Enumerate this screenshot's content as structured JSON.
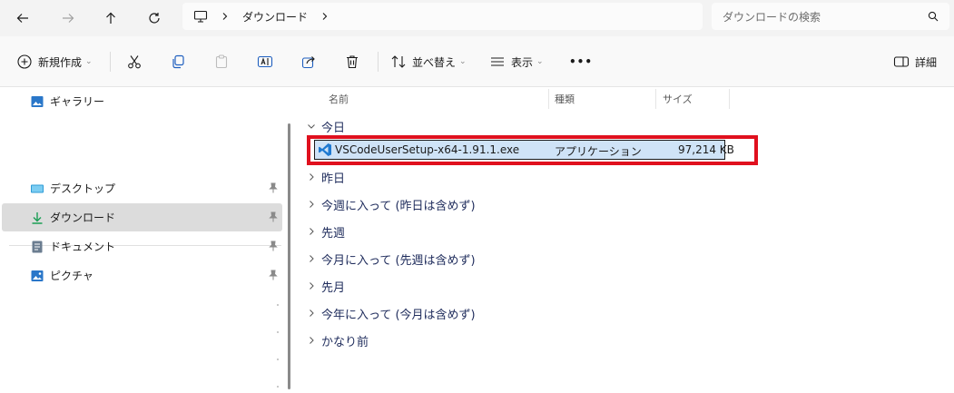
{
  "nav": {
    "back_icon": "arrow-left-icon",
    "forward_icon": "arrow-right-icon",
    "up_icon": "arrow-up-icon",
    "refresh_icon": "refresh-icon"
  },
  "address": {
    "location_icon": "computer-icon",
    "segments": [
      "ダウンロード"
    ]
  },
  "search": {
    "placeholder": "ダウンロードの検索"
  },
  "toolbar": {
    "new_label": "新規作成",
    "sort_label": "並べ替え",
    "view_label": "表示",
    "more_label": "•••",
    "details_label": "詳細"
  },
  "sidebar": {
    "items": [
      {
        "label": "ギャラリー",
        "icon": "gallery-icon"
      },
      {
        "label": "デスクトップ",
        "icon": "desktop-icon",
        "pinned": true
      },
      {
        "label": "ダウンロード",
        "icon": "download-icon",
        "pinned": true,
        "selected": true
      },
      {
        "label": "ドキュメント",
        "icon": "document-icon",
        "pinned": true
      },
      {
        "label": "ピクチャ",
        "icon": "pictures-icon",
        "pinned": true
      }
    ]
  },
  "columns": {
    "name": "名前",
    "type": "種類",
    "size": "サイズ"
  },
  "groups": [
    {
      "label": "今日",
      "expanded": true
    },
    {
      "label": "昨日"
    },
    {
      "label": "今週に入って (昨日は含めず)"
    },
    {
      "label": "先週"
    },
    {
      "label": "今月に入って (先週は含めず)"
    },
    {
      "label": "先月"
    },
    {
      "label": "今年に入って (今月は含めず)"
    },
    {
      "label": "かなり前"
    }
  ],
  "files": [
    {
      "name": "VSCodeUserSetup-x64-1.91.1.exe",
      "type": "アプリケーション",
      "size": "97,214 KB",
      "icon": "vscode-icon"
    }
  ],
  "colors": {
    "highlight_border": "#e0101e",
    "selection_bg": "#cfe3f7",
    "group_text": "#1f2c5c"
  }
}
